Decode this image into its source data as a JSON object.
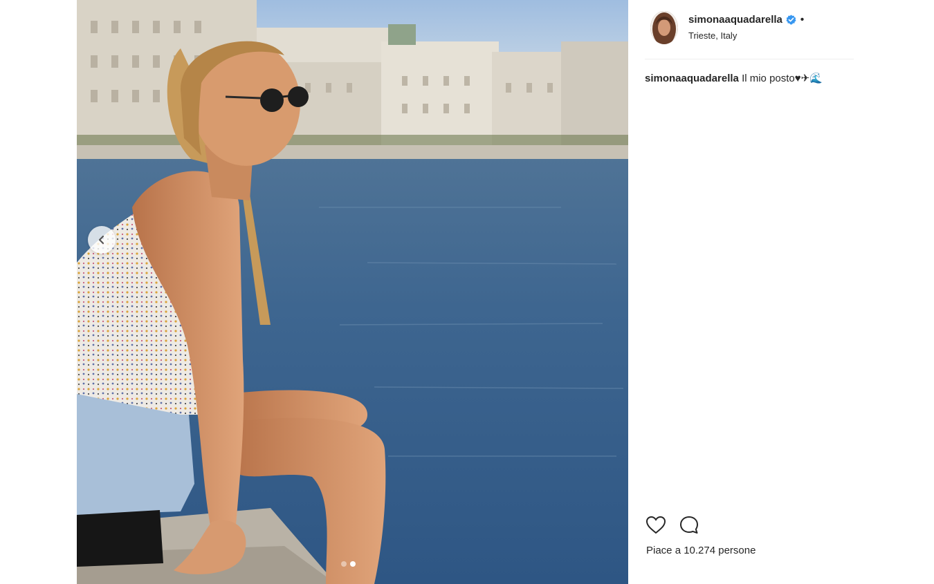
{
  "post": {
    "username": "simonaaquadarella",
    "verified": true,
    "separator": "•",
    "location": "Trieste, Italy",
    "caption_username": "simonaaquadarella",
    "caption_text": "Il mio posto♥✈🌊",
    "likes_text": "Piace a 10.274 persone",
    "carousel": {
      "total_slides": 2,
      "active_slide": 2
    }
  },
  "icons": {
    "prev": "chevron-left-icon",
    "verified": "verified-badge-icon",
    "like": "heart-outline-icon",
    "comment": "comment-bubble-icon"
  },
  "colors": {
    "verified_blue": "#3897f0",
    "text": "#262626",
    "divider": "#efefef"
  }
}
